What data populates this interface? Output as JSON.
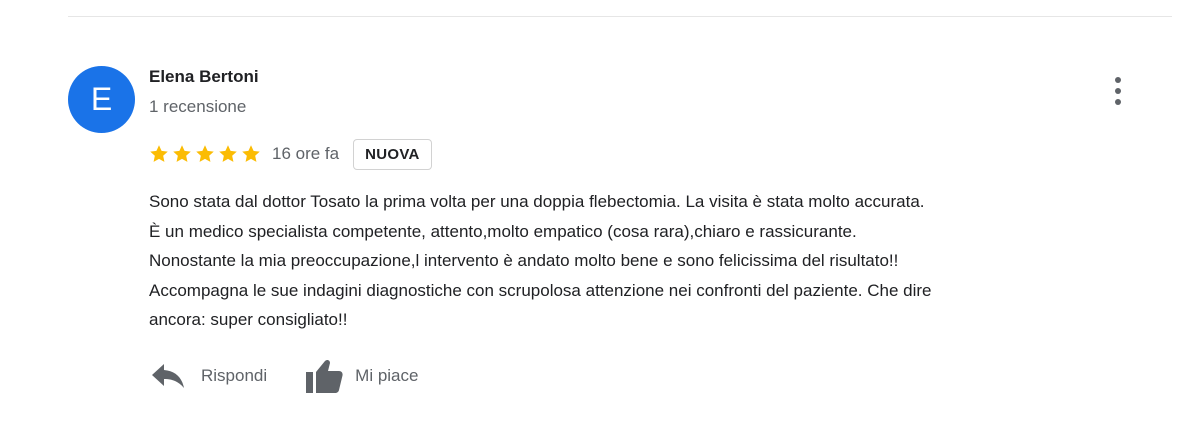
{
  "review": {
    "avatar_letter": "E",
    "avatar_color": "#1a73e8",
    "author_name": "Elena Bertoni",
    "review_count": "1 recensione",
    "rating": 5,
    "rating_max": 5,
    "star_color": "#fbbc04",
    "time_ago": "16 ore fa",
    "badge": "NUOVA",
    "text_lines": [
      "Sono stata dal dottor Tosato la prima volta per una doppia flebectomia. La visita è stata molto accurata.",
      "È un medico specialista competente, attento,molto empatico (cosa rara),chiaro e rassicurante.",
      "Nonostante la mia preoccupazione,l intervento è andato molto bene e sono felicissima del risultato!!",
      "Accompagna le sue indagini diagnostiche con scrupolosa attenzione nei confronti del paziente. Che dire",
      "ancora: super consigliato!!"
    ],
    "actions": {
      "reply_label": "Rispondi",
      "like_label": "Mi piace"
    }
  },
  "icons": {
    "more": "more-vert-icon",
    "star": "star-icon",
    "reply": "reply-icon",
    "like": "thumb-up-icon"
  }
}
